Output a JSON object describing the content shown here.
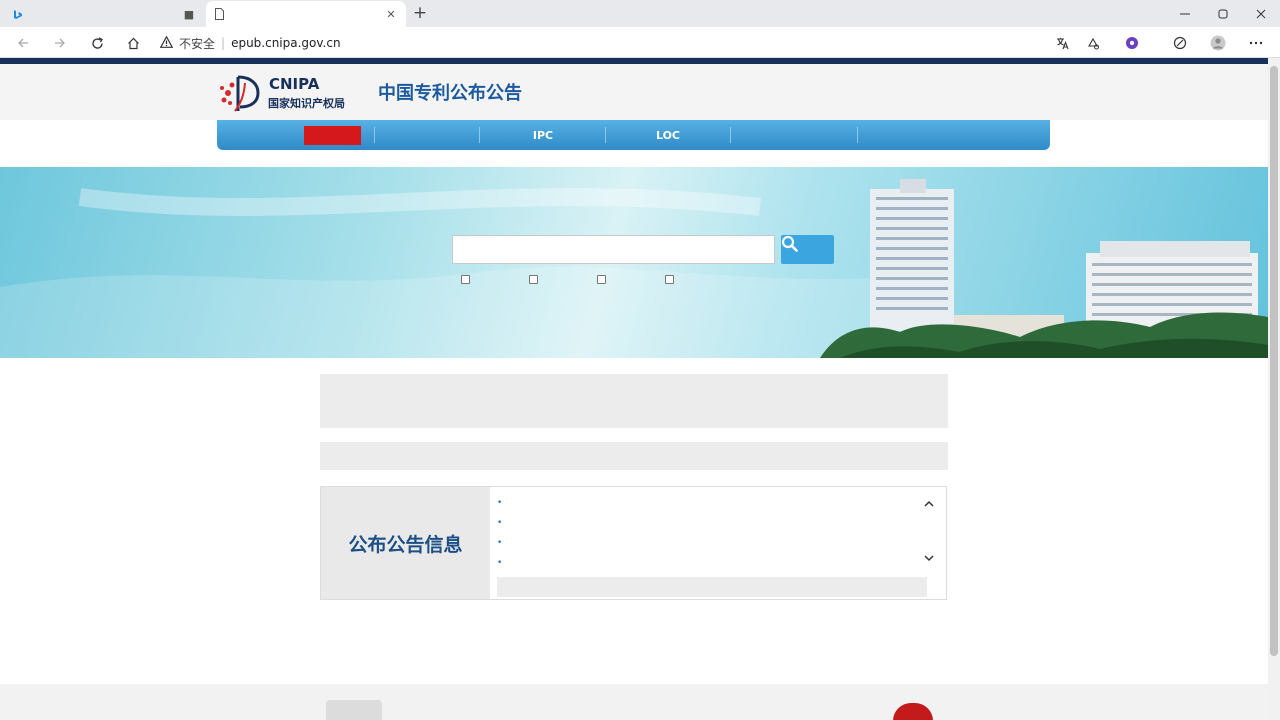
{
  "browser": {
    "tabs": [
      {
        "title": "",
        "active": false
      },
      {
        "title": "",
        "active": true
      }
    ],
    "new_tab_label": "+",
    "address": {
      "security_label": "不安全",
      "separator": "|",
      "url": "epub.cnipa.gov.cn"
    }
  },
  "site": {
    "logo": {
      "abbr": "CNIPA",
      "agency": "国家知识产权局"
    },
    "title": "中国专利公布公告",
    "nav": [
      {
        "label": "",
        "active": true
      },
      {
        "label": "",
        "active": false
      },
      {
        "label": "IPC",
        "active": false
      },
      {
        "label": "LOC",
        "active": false
      },
      {
        "label": "",
        "active": false
      },
      {
        "label": "",
        "active": false
      }
    ],
    "search": {
      "label": "",
      "placeholder": "",
      "options": [
        {
          "label": ""
        },
        {
          "label": ""
        },
        {
          "label": ""
        },
        {
          "label": ""
        }
      ],
      "advanced_link": ""
    },
    "notice": "",
    "data_range": "",
    "info": {
      "heading": "公布公告信息",
      "items": [
        {
          "text": ""
        },
        {
          "text": ""
        },
        {
          "text": ""
        },
        {
          "text": ""
        }
      ],
      "footer_label": ""
    },
    "footer": {
      "links": ""
    }
  },
  "watermark": ""
}
